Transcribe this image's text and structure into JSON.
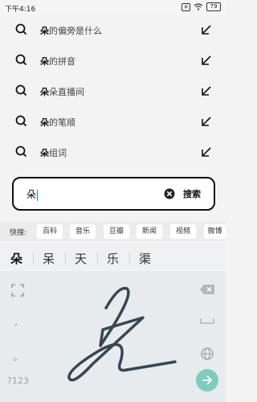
{
  "status_bar": {
    "time": "下午4:16",
    "battery": "79"
  },
  "suggestions": [
    {
      "bold": "朵",
      "rest": "的偏旁是什么"
    },
    {
      "bold": "朵",
      "rest": "的拼音"
    },
    {
      "bold": "朵",
      "rest": "朵直播间"
    },
    {
      "bold": "朵",
      "rest": "的笔顺"
    },
    {
      "bold": "朵",
      "rest": "组词"
    }
  ],
  "search": {
    "value": "朵",
    "button_label": "搜索"
  },
  "quick_search": {
    "label": "快搜:",
    "chips": [
      "百科",
      "音乐",
      "豆瓣",
      "新闻",
      "视频",
      "微博"
    ]
  },
  "candidates": [
    "朵",
    "呆",
    "天",
    "乐",
    "渠"
  ],
  "keyboard": {
    "comma": ",",
    "period": "。",
    "num_label": "?123"
  },
  "colors": {
    "enter": "#7fcbbd",
    "caret": "#1e88e5",
    "ink": "#37474f"
  }
}
